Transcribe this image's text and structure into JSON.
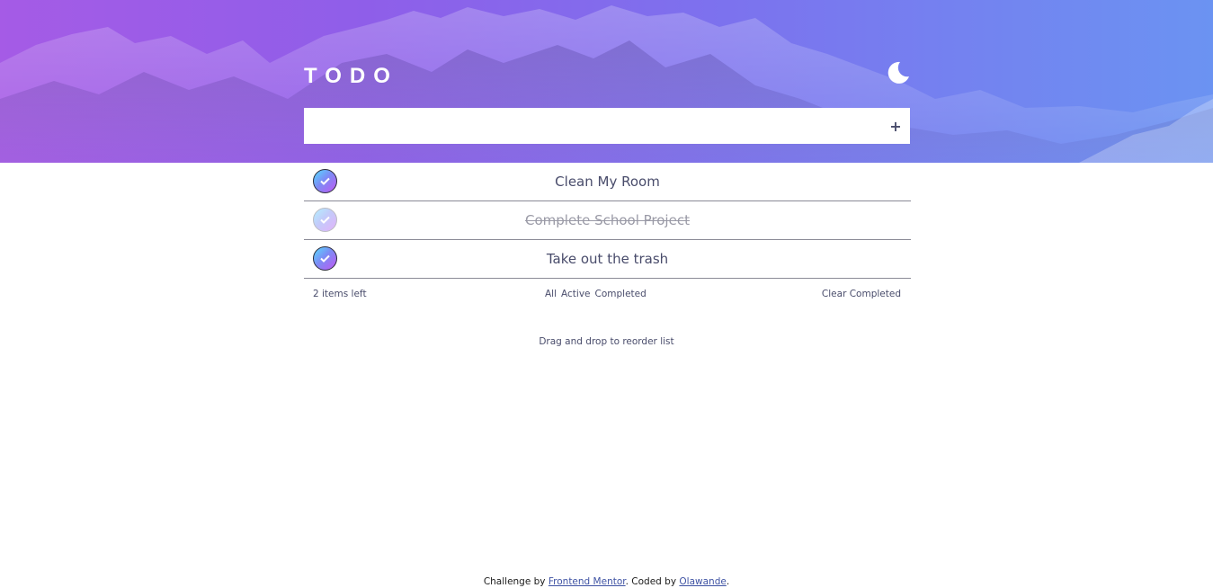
{
  "header": {
    "title": "TODO",
    "theme_icon": "moon-icon",
    "background_image": "mountain-landscape-image"
  },
  "new_todo": {
    "value": "",
    "placeholder": "",
    "add_icon": "plus-icon",
    "add_label": "+"
  },
  "todos": [
    {
      "text": "Clean My Room",
      "completed": false
    },
    {
      "text": "Complete School Project",
      "completed": true
    },
    {
      "text": "Take out the trash",
      "completed": false
    }
  ],
  "footer": {
    "items_left": "2 items left",
    "filters": [
      "All",
      "Active",
      "Completed"
    ],
    "clear_label": "Clear Completed"
  },
  "hint": "Drag and drop to reorder list",
  "attribution": {
    "prefix": "Challenge by ",
    "link1": "Frontend Mentor",
    "middle": ". Coded by ",
    "link2": "Olawande",
    "suffix": "."
  },
  "colors": {
    "gradient_start": "#a55be6",
    "gradient_end": "#6b93f2",
    "check_gradient_start": "#57ddff",
    "check_gradient_end": "#c058f3",
    "text": "#494c6b",
    "completed_text": "#9a9aa6"
  }
}
